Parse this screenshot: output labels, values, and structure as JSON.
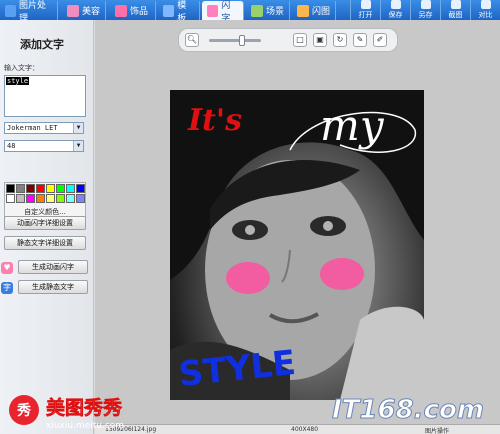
{
  "tabs": [
    {
      "label": "图片处理",
      "color": "#5aa0f0"
    },
    {
      "label": "美容",
      "color": "#f08cc0"
    },
    {
      "label": "饰品",
      "color": "#ff6fa8"
    },
    {
      "label": "模板",
      "color": "#7fb8ff"
    },
    {
      "label": "闪字",
      "color": "#ff7fbf",
      "active": true
    },
    {
      "label": "场景",
      "color": "#9ad06a"
    },
    {
      "label": "闪图",
      "color": "#ffb74d"
    }
  ],
  "right_tools": [
    "打开",
    "保存",
    "另存",
    "截图",
    "对比"
  ],
  "panel": {
    "title": "添加文字",
    "input_label": "输入文字：",
    "input_value": "style",
    "font_name": "Jokerman LET",
    "font_size": "48",
    "custom_color_label": "自定义颜色...",
    "palette": [
      "#000000",
      "#808080",
      "#800000",
      "#ff0000",
      "#ffff00",
      "#00ff00",
      "#00ffff",
      "#0000ff",
      "#ffffff",
      "#c0c0c0",
      "#ff00ff",
      "#ff8000",
      "#ffff80",
      "#80ff00",
      "#80ffff",
      "#8080ff"
    ],
    "btn_anim_settings": "动画闪字详细设置",
    "btn_static_settings": "静态文字详细设置",
    "btn_gen_anim": "生成动画闪字",
    "btn_gen_static": "生成静态文字",
    "side_icon_text": "字"
  },
  "canvas": {
    "text_its": "It's",
    "text_my": "my",
    "text_style": "STYLE",
    "colors": {
      "its": "#e01010",
      "my": "#ffffff",
      "style": "#1030e0",
      "blush": "#ff4f9f"
    }
  },
  "footer": {
    "filename": "1309206I124.jpg",
    "dimensions": "400X480",
    "ops_label": "图片操作"
  },
  "watermarks": {
    "left_icon": "秀",
    "left_title": "美图秀秀",
    "left_url": "xiuxiu.meitu.com",
    "right": "IT168.com"
  }
}
